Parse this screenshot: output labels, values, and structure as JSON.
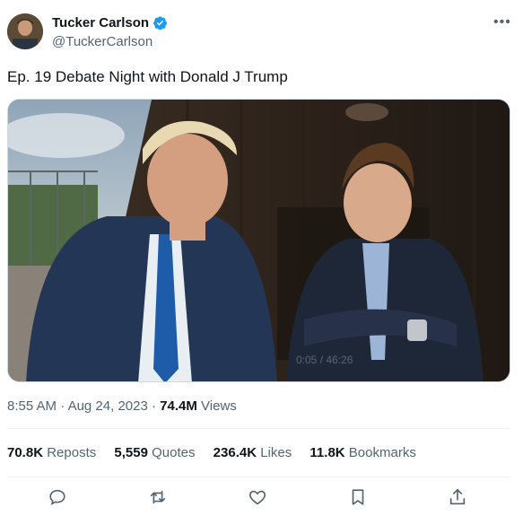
{
  "author": {
    "name": "Tucker Carlson",
    "handle": "@TuckerCarlson"
  },
  "tweet": {
    "text": "Ep. 19  Debate Night with Donald J Trump"
  },
  "video": {
    "time_overlay": "0:05 / 46:26"
  },
  "meta": {
    "time": "8:55 AM",
    "sep1": "·",
    "date": "Aug 24, 2023",
    "sep2": "·",
    "views_count": "74.4M",
    "views_label": "Views"
  },
  "stats": [
    {
      "count": "70.8K",
      "label": "Reposts"
    },
    {
      "count": "5,559",
      "label": "Quotes"
    },
    {
      "count": "236.4K",
      "label": "Likes"
    },
    {
      "count": "11.8K",
      "label": "Bookmarks"
    }
  ],
  "actions": [
    "reply-icon",
    "repost-icon",
    "like-icon",
    "bookmark-icon",
    "share-icon"
  ],
  "colors": {
    "accent": "#1d9bf0",
    "muted": "#536471",
    "text": "#0f1419"
  }
}
